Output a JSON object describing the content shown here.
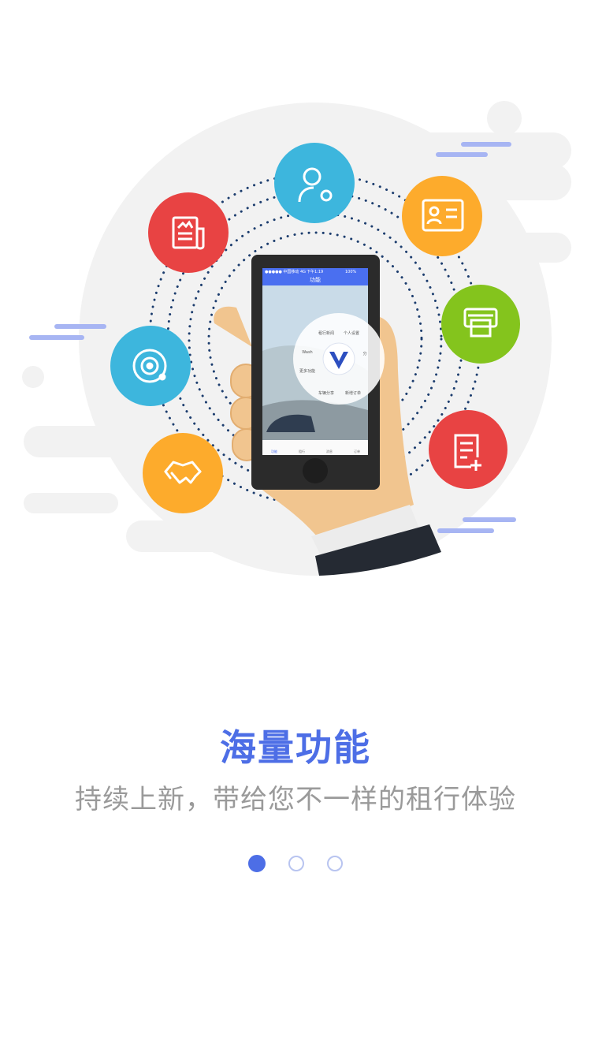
{
  "colors": {
    "accent": "#4d6ee6",
    "subtitle": "#9a9a9a",
    "red": "#e84343",
    "blue": "#3db6dd",
    "orange": "#fdab2c",
    "green": "#84c41d",
    "phone_top_bar": "#4a6ff0"
  },
  "icons": [
    "news-icon",
    "user-settings-icon",
    "id-card-icon",
    "printer-icon",
    "new-order-icon",
    "target-icon",
    "handshake-icon",
    "app-logo-icon"
  ],
  "phone": {
    "status_left": "●●●●● 中国移动 4G",
    "status_time": "下午1:19",
    "status_right": "100%",
    "header_title": "功能",
    "menu": {
      "item_news": "租行新闻",
      "item_settings": "个人设置",
      "item_wash": "Wash",
      "item_more": "更多功能",
      "item_share": "车辆分享",
      "item_order": "新增订单",
      "item_cut": "分"
    },
    "tabs": [
      "功能",
      "租行",
      "消息",
      "订单"
    ]
  },
  "onboarding": {
    "title": "海量功能",
    "subtitle": "持续上新，带给您不一样的租行体验",
    "pages": 3,
    "current_page": 1
  }
}
